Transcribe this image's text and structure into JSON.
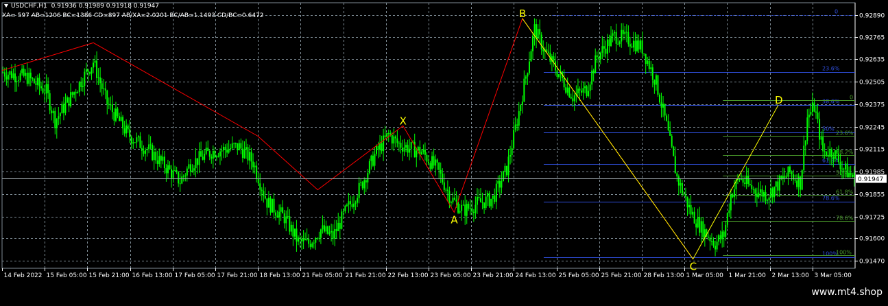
{
  "header": {
    "symbol": "USDCHF,H1",
    "ohlc": "0.91936 0.91989 0.91918 0.91947",
    "pattern_info": "XA= 597 AB=1206 BC=1386 CD=897 AB/XA=2.0201 BC/AB=1.1493 CD/BC=0.6472"
  },
  "watermark": "www.mt4.shop",
  "colors": {
    "background": "#000000",
    "candles": "#00ff00",
    "grid": "#7f8d96",
    "pattern_xabc": "#ff0000",
    "pattern_bcd": "#ffff00",
    "fib_main": "#3050e0",
    "fib_secondary": "#4a9a2a",
    "point_labels": "#ffff00",
    "price_box": "#ffffff"
  },
  "chart_data": {
    "type": "candlestick",
    "symbol": "USDCHF",
    "timeframe": "H1",
    "ylim": [
      0.9147,
      0.9289
    ],
    "y_ticks": [
      "0.92890",
      "0.92765",
      "0.92635",
      "0.92505",
      "0.92375",
      "0.92245",
      "0.92115",
      "0.91985",
      "0.91855",
      "0.91725",
      "0.91600",
      "0.91470"
    ],
    "x_ticks": [
      "14 Feb 2022",
      "15 Feb 05:00",
      "15 Feb 21:00",
      "16 Feb 13:00",
      "17 Feb 05:00",
      "17 Feb 21:00",
      "18 Feb 13:00",
      "21 Feb 05:00",
      "21 Feb 21:00",
      "22 Feb 13:00",
      "23 Feb 05:00",
      "23 Feb 21:00",
      "24 Feb 13:00",
      "25 Feb 05:00",
      "25 Feb 21:00",
      "28 Feb 13:00",
      "1 Mar 05:00",
      "1 Mar 21:00",
      "2 Mar 13:00",
      "3 Mar 05:00"
    ],
    "current_price": "0.91947",
    "price_path": [
      [
        0,
        0.9256
      ],
      [
        14,
        0.9253
      ],
      [
        25,
        0.9245
      ],
      [
        30,
        0.9228
      ],
      [
        40,
        0.9243
      ],
      [
        52,
        0.9262
      ],
      [
        60,
        0.9238
      ],
      [
        72,
        0.922
      ],
      [
        85,
        0.921
      ],
      [
        95,
        0.92
      ],
      [
        102,
        0.9193
      ],
      [
        108,
        0.9203
      ],
      [
        120,
        0.921
      ],
      [
        136,
        0.9213
      ],
      [
        144,
        0.9204
      ],
      [
        152,
        0.9181
      ],
      [
        162,
        0.9172
      ],
      [
        170,
        0.9158
      ],
      [
        176,
        0.9157
      ],
      [
        183,
        0.9165
      ],
      [
        190,
        0.9161
      ],
      [
        197,
        0.9175
      ],
      [
        206,
        0.919
      ],
      [
        214,
        0.9208
      ],
      [
        222,
        0.922
      ],
      [
        227,
        0.9215
      ],
      [
        234,
        0.9212
      ],
      [
        241,
        0.921
      ],
      [
        250,
        0.92
      ],
      [
        258,
        0.9183
      ],
      [
        265,
        0.9176
      ],
      [
        273,
        0.918
      ],
      [
        282,
        0.9183
      ],
      [
        290,
        0.92
      ],
      [
        297,
        0.9233
      ],
      [
        302,
        0.9259
      ],
      [
        306,
        0.9281
      ],
      [
        312,
        0.9268
      ],
      [
        320,
        0.9255
      ],
      [
        328,
        0.9242
      ],
      [
        336,
        0.9246
      ],
      [
        342,
        0.9265
      ],
      [
        352,
        0.9277
      ],
      [
        360,
        0.9275
      ],
      [
        368,
        0.927
      ],
      [
        376,
        0.925
      ],
      [
        382,
        0.9225
      ],
      [
        388,
        0.9195
      ],
      [
        396,
        0.9175
      ],
      [
        402,
        0.9166
      ],
      [
        410,
        0.9157
      ],
      [
        415,
        0.9162
      ],
      [
        419,
        0.9185
      ],
      [
        424,
        0.9195
      ],
      [
        432,
        0.9188
      ],
      [
        440,
        0.9185
      ],
      [
        447,
        0.9192
      ],
      [
        453,
        0.9198
      ],
      [
        459,
        0.9192
      ],
      [
        463,
        0.923
      ],
      [
        467,
        0.9236
      ],
      [
        472,
        0.921
      ],
      [
        478,
        0.921
      ],
      [
        484,
        0.92
      ],
      [
        490,
        0.9195
      ]
    ],
    "labels_on_chart": [
      "X",
      "A",
      "B",
      "C",
      "D"
    ],
    "pattern_points": {
      "X": [
        0.9225,
        0.9225
      ],
      "A": [
        0.9175,
        0.9175
      ],
      "B": [
        0.9287,
        0.9287
      ],
      "C": [
        0.9148,
        0.9148
      ],
      "D": [
        0.9237,
        0.9237
      ]
    },
    "zigzag": [
      [
        0,
        0.9257
      ],
      [
        0.107,
        0.9273
      ],
      [
        0.3,
        0.9219
      ],
      [
        0.37,
        0.9188
      ],
      [
        0.47,
        0.9225
      ],
      [
        0.53,
        0.9175
      ],
      [
        0.61,
        0.9287
      ],
      [
        0.81,
        0.9148
      ],
      [
        0.91,
        0.9237
      ]
    ],
    "fib_main": {
      "0": 0.9289,
      "23.6%": 0.9256,
      "38.6%": 0.9237,
      "50%": 0.9221,
      "61.8%": 0.9203,
      "78.6%": 0.9181,
      "100%": 0.9149
    },
    "fib_main_labels": [
      "0",
      "23.6%",
      "38.6%",
      "50%",
      "61.8%",
      "78.6%",
      "100%"
    ],
    "fib_secondary": {
      "0": 0.924,
      "23.6%": 0.9219,
      "38.2%": 0.9208,
      "50%": 0.9196,
      "61.8%": 0.9185,
      "78.6%": 0.917,
      "100%": 0.915
    },
    "fib_secondary_labels": [
      "0",
      "23.6%",
      "38.2%",
      "50%",
      "61.8%",
      "78.6%",
      "100%"
    ]
  }
}
